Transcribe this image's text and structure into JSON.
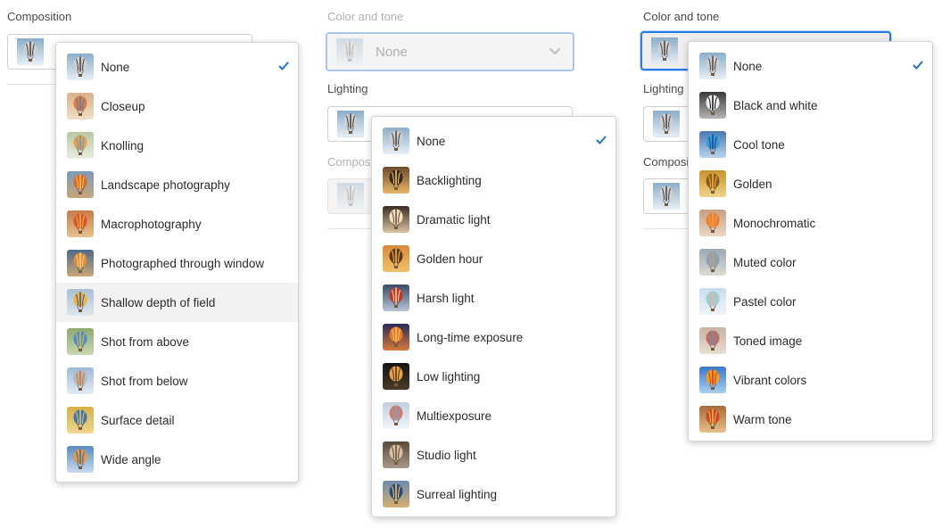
{
  "left": {
    "label": "Composition",
    "menu": {
      "items": [
        {
          "label": "None",
          "thumb": [
            "#8aaec9",
            "#e8eff5"
          ],
          "balloon": [
            "#cfcfcf",
            "#4a4a4a"
          ],
          "selected": true
        },
        {
          "label": "Closeup",
          "thumb": [
            "#d9b08a",
            "#f2dfc8"
          ],
          "balloon": [
            "#e37b3c",
            "#4a7fc2"
          ]
        },
        {
          "label": "Knolling",
          "thumb": [
            "#b8c7a2",
            "#e9efe1"
          ],
          "balloon": [
            "#e9a04a",
            "#5c9cc9"
          ]
        },
        {
          "label": "Landscape photography",
          "thumb": [
            "#7a9ab8",
            "#c8a67c"
          ],
          "balloon": [
            "#d86a2e",
            "#f0c050"
          ]
        },
        {
          "label": "Macrophotography",
          "thumb": [
            "#c77a4a",
            "#e8c190"
          ],
          "balloon": [
            "#d8552c",
            "#e8b24a"
          ]
        },
        {
          "label": "Photographed through window",
          "thumb": [
            "#4d6b8a",
            "#cba778"
          ],
          "balloon": [
            "#e18a3c",
            "#f2d27a"
          ]
        },
        {
          "label": "Shallow depth of field",
          "thumb": [
            "#a8bfd4",
            "#dde6ee"
          ],
          "balloon": [
            "#f0b43c",
            "#3b5e9a"
          ]
        },
        {
          "label": "Shot from above",
          "thumb": [
            "#8ea86e",
            "#c9d8b0"
          ],
          "balloon": [
            "#4b8fd0",
            "#e6b63c"
          ]
        },
        {
          "label": "Shot from below",
          "thumb": [
            "#9fb9d6",
            "#e3ecf5"
          ],
          "balloon": [
            "#b6b6b6",
            "#d27a3c"
          ]
        },
        {
          "label": "Surface detail",
          "thumb": [
            "#d6b04a",
            "#eed78f"
          ],
          "balloon": [
            "#3d74b8",
            "#e8c44a"
          ]
        },
        {
          "label": "Wide angle",
          "thumb": [
            "#5d8ac0",
            "#c7dbee"
          ],
          "balloon": [
            "#e89a3a",
            "#3e6fb0"
          ]
        }
      ]
    }
  },
  "middle": {
    "color_label": "Color and tone",
    "color_value": "None",
    "lighting_label": "Lighting",
    "composition_label": "Composi",
    "menu": {
      "items": [
        {
          "label": "None",
          "thumb": [
            "#8aaec9",
            "#e8eff5"
          ],
          "balloon": [
            "#cfcfcf",
            "#4a4a4a"
          ],
          "selected": true
        },
        {
          "label": "Backlighting",
          "thumb": [
            "#6b4a2a",
            "#e9b56a"
          ],
          "balloon": [
            "#3a2a1a",
            "#f0c070"
          ]
        },
        {
          "label": "Dramatic light",
          "thumb": [
            "#3a2c22",
            "#d8c2a2"
          ],
          "balloon": [
            "#f3e0c0",
            "#6b5040"
          ]
        },
        {
          "label": "Golden hour",
          "thumb": [
            "#d88a3a",
            "#f2c26a"
          ],
          "balloon": [
            "#5a3a1a",
            "#f2b04a"
          ]
        },
        {
          "label": "Harsh light",
          "thumb": [
            "#3b4a66",
            "#b8c4d8"
          ],
          "balloon": [
            "#c0392b",
            "#f0d0a0"
          ]
        },
        {
          "label": "Long-time exposure",
          "thumb": [
            "#2a2a5a",
            "#d87a3a"
          ],
          "balloon": [
            "#e07a2a",
            "#f5c060"
          ]
        },
        {
          "label": "Low lighting",
          "thumb": [
            "#141414",
            "#4a3a2a"
          ],
          "balloon": [
            "#e7a24a",
            "#5a3a1a"
          ]
        },
        {
          "label": "Multiexposure",
          "thumb": [
            "#c0cfe0",
            "#f1f4f8"
          ],
          "balloon": [
            "#d27a6a",
            "#8aa0c0"
          ]
        },
        {
          "label": "Studio light",
          "thumb": [
            "#5a4a3a",
            "#a89888"
          ],
          "balloon": [
            "#d8c0a0",
            "#6a5040"
          ]
        },
        {
          "label": "Surreal lighting",
          "thumb": [
            "#6a8ab0",
            "#d8b070"
          ],
          "balloon": [
            "#2a4a7a",
            "#f0c060"
          ]
        }
      ]
    }
  },
  "right": {
    "color_label": "Color and tone",
    "lighting_label": "Lighting",
    "composition_label": "Composi",
    "menu": {
      "items": [
        {
          "label": "None",
          "thumb": [
            "#8aaec9",
            "#e8eff5"
          ],
          "balloon": [
            "#cfcfcf",
            "#4a4a4a"
          ],
          "selected": true
        },
        {
          "label": "Black and white",
          "thumb": [
            "#3a3a3a",
            "#b5b5b5"
          ],
          "balloon": [
            "#f0f0f0",
            "#202020"
          ]
        },
        {
          "label": "Cool tone",
          "thumb": [
            "#4a7ab0",
            "#b8d4ec"
          ],
          "balloon": [
            "#3a9ad8",
            "#1a4a8a"
          ]
        },
        {
          "label": "Golden",
          "thumb": [
            "#c8922a",
            "#f0d48a"
          ],
          "balloon": [
            "#8a5a1a",
            "#f2b23a"
          ]
        },
        {
          "label": "Monochromatic",
          "thumb": [
            "#c8a080",
            "#ead6c4"
          ],
          "balloon": [
            "#e88030",
            "#f0a050"
          ]
        },
        {
          "label": "Muted color",
          "thumb": [
            "#9aa8b4",
            "#dcdcd4"
          ],
          "balloon": [
            "#8aa0b0",
            "#c0a080"
          ]
        },
        {
          "label": "Pastel color",
          "thumb": [
            "#c8dcec",
            "#f0f4f8"
          ],
          "balloon": [
            "#9ad0c8",
            "#e8b0b8"
          ]
        },
        {
          "label": "Toned image",
          "thumb": [
            "#c8b4a4",
            "#e8dcd0"
          ],
          "balloon": [
            "#c06a5a",
            "#7a8ab0"
          ]
        },
        {
          "label": "Vibrant colors",
          "thumb": [
            "#3a78c8",
            "#a8d0f0"
          ],
          "balloon": [
            "#e8a020",
            "#d83a2a"
          ]
        },
        {
          "label": "Warm tone",
          "thumb": [
            "#a86a3a",
            "#e8c08a"
          ],
          "balloon": [
            "#c84a2a",
            "#f0b040"
          ]
        }
      ]
    }
  },
  "colors": {
    "accent": "#2b7be4",
    "check": "#1d6fd6"
  }
}
